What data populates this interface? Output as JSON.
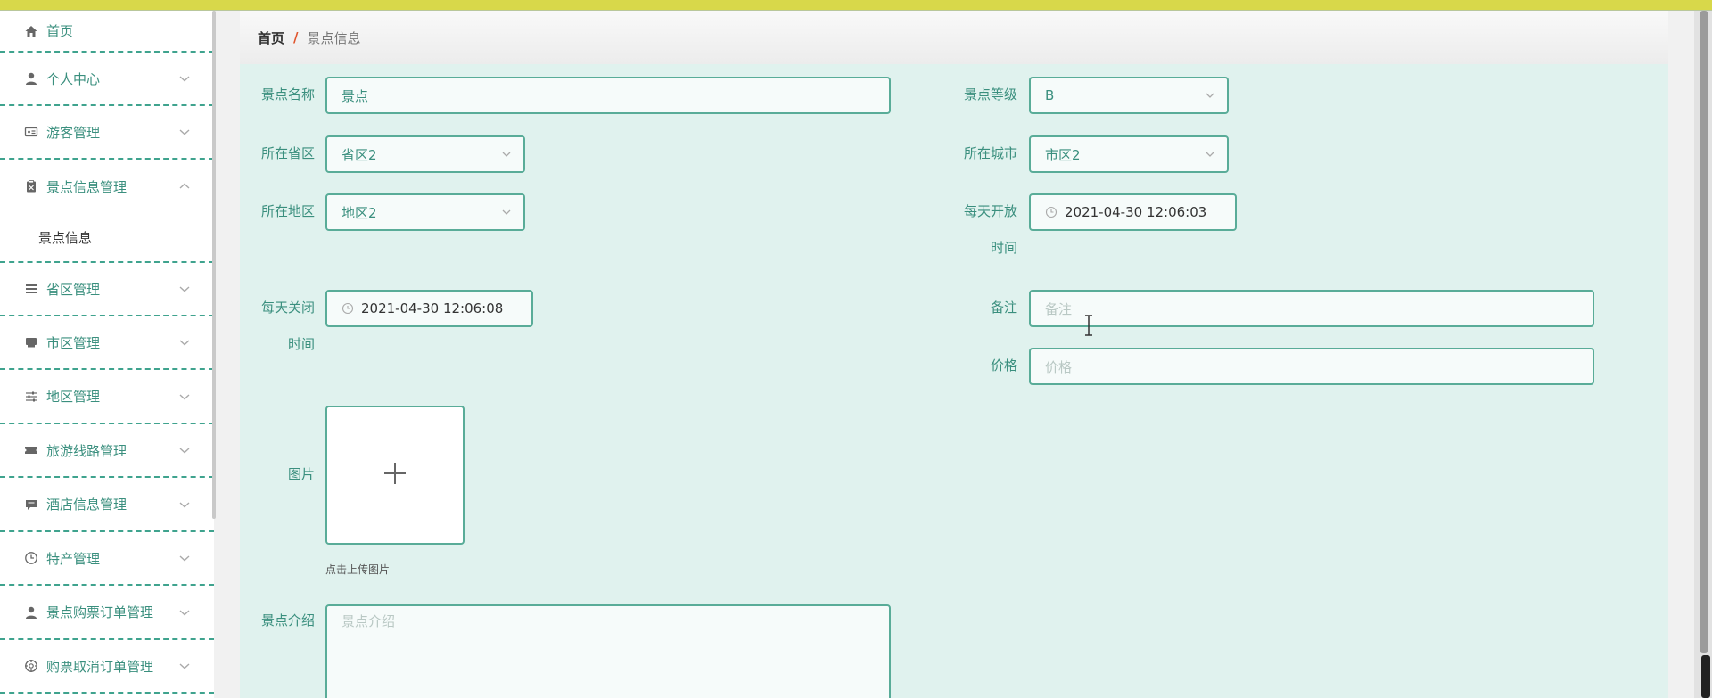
{
  "sidebar": {
    "items": [
      {
        "label": "首页",
        "icon": "home-icon"
      },
      {
        "label": "个人中心",
        "icon": "user-icon"
      },
      {
        "label": "游客管理",
        "icon": "id-card-icon"
      },
      {
        "label": "景点信息管理",
        "icon": "clipboard-icon"
      },
      {
        "label": "省区管理",
        "icon": "list-icon"
      },
      {
        "label": "市区管理",
        "icon": "building-icon"
      },
      {
        "label": "地区管理",
        "icon": "sliders-icon"
      },
      {
        "label": "旅游线路管理",
        "icon": "ticket-icon"
      },
      {
        "label": "酒店信息管理",
        "icon": "message-icon"
      },
      {
        "label": "特产管理",
        "icon": "clock-icon"
      },
      {
        "label": "景点购票订单管理",
        "icon": "user-icon"
      },
      {
        "label": "购票取消订单管理",
        "icon": "target-icon"
      }
    ],
    "submenu_label": "景点信息"
  },
  "breadcrumb": {
    "home": "首页",
    "separator": "/",
    "current": "景点信息"
  },
  "form": {
    "name_label": "景点名称",
    "name_value": "景点",
    "level_label": "景点等级",
    "level_value": "B",
    "province_label": "所在省区",
    "province_value": "省区2",
    "city_label": "所在城市",
    "city_value": "市区2",
    "district_label": "所在地区",
    "district_value": "地区2",
    "open_label_1": "每天开放",
    "open_label_2": "时间",
    "open_value": "2021-04-30 12:06:03",
    "close_label_1": "每天关闭",
    "close_label_2": "时间",
    "close_value": "2021-04-30 12:06:08",
    "remark_label": "备注",
    "remark_placeholder": "备注",
    "price_label": "价格",
    "price_placeholder": "价格",
    "image_label": "图片",
    "upload_hint": "点击上传图片",
    "intro_label": "景点介绍",
    "intro_placeholder": "景点介绍"
  },
  "colors": {
    "accent": "#3a8f7e",
    "border": "#59ac98",
    "panel_bg": "#e0f2ee",
    "topbar": "#d8d84a",
    "separator": "#e0542c"
  }
}
